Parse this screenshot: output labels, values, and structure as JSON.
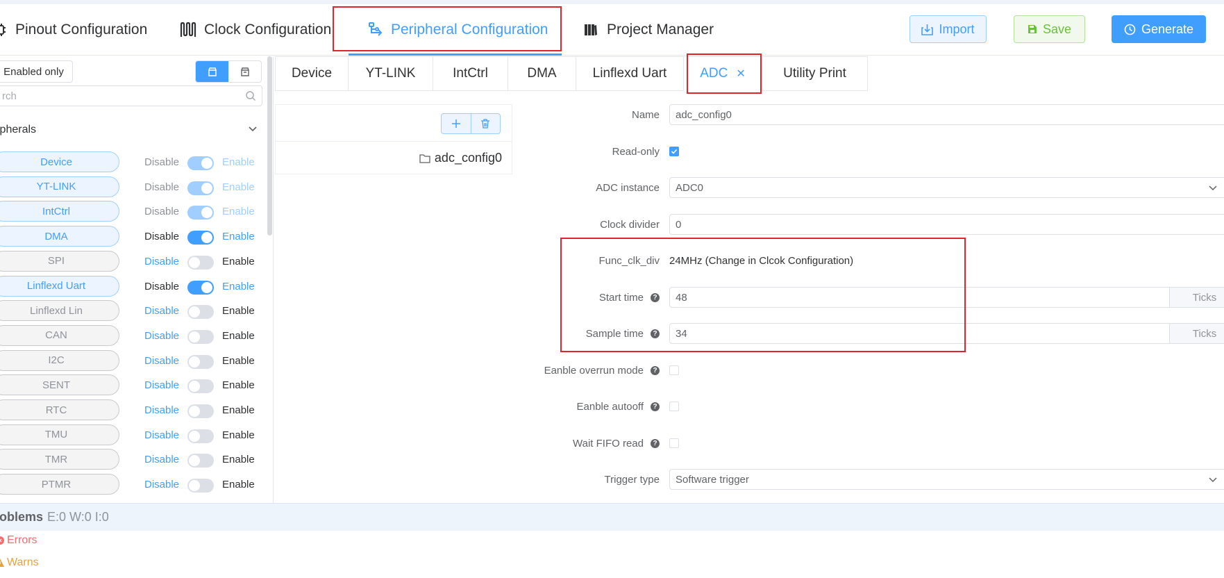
{
  "nav": {
    "tabs": [
      {
        "label": "Pinout Configuration",
        "icon": "chip-icon"
      },
      {
        "label": "Clock Configuration",
        "icon": "clock-wave-icon"
      },
      {
        "label": "Peripheral Configuration",
        "icon": "peripheral-icon"
      },
      {
        "label": "Project Manager",
        "icon": "book-icon"
      }
    ],
    "active": "Peripheral Configuration"
  },
  "actions": {
    "import": "Import",
    "save": "Save",
    "generate": "Generate"
  },
  "left": {
    "enabled_only": "Enabled only",
    "search_placeholder": "rch",
    "section_title": "ipherals",
    "disable_label": "Disable",
    "enable_label": "Enable",
    "peripherals": [
      {
        "name": "Device",
        "enabled": true,
        "locked": true
      },
      {
        "name": "YT-LINK",
        "enabled": true,
        "locked": true
      },
      {
        "name": "IntCtrl",
        "enabled": true,
        "locked": true
      },
      {
        "name": "DMA",
        "enabled": true,
        "locked": false
      },
      {
        "name": "SPI",
        "enabled": false,
        "locked": false
      },
      {
        "name": "Linflexd Uart",
        "enabled": true,
        "locked": false
      },
      {
        "name": "Linflexd Lin",
        "enabled": false,
        "locked": false
      },
      {
        "name": "CAN",
        "enabled": false,
        "locked": false
      },
      {
        "name": "I2C",
        "enabled": false,
        "locked": false
      },
      {
        "name": "SENT",
        "enabled": false,
        "locked": false
      },
      {
        "name": "RTC",
        "enabled": false,
        "locked": false
      },
      {
        "name": "TMU",
        "enabled": false,
        "locked": false
      },
      {
        "name": "TMR",
        "enabled": false,
        "locked": false
      },
      {
        "name": "PTMR",
        "enabled": false,
        "locked": false
      }
    ]
  },
  "peripheral_tabs": [
    "Device",
    "YT-LINK",
    "IntCtrl",
    "DMA",
    "Linflexd Uart",
    "ADC",
    "Utility Print"
  ],
  "active_peripheral_tab": "ADC",
  "config_list": {
    "items": [
      "adc_config0"
    ]
  },
  "form": {
    "name": {
      "label": "Name",
      "value": "adc_config0"
    },
    "readonly": {
      "label": "Read-only",
      "checked": true
    },
    "instance": {
      "label": "ADC instance",
      "value": "ADC0"
    },
    "clock_divider": {
      "label": "Clock divider",
      "value": "0"
    },
    "func_clk_div": {
      "label": "Func_clk_div",
      "value": "24MHz (Change in Clcok Configuration)"
    },
    "start_time": {
      "label": "Start time",
      "value": "48",
      "unit": "Ticks"
    },
    "sample_time": {
      "label": "Sample time",
      "value": "34",
      "unit": "Ticks"
    },
    "overrun": {
      "label": "Eanble overrun mode",
      "checked": false
    },
    "autooff": {
      "label": "Eanble autooff",
      "checked": false
    },
    "wait_fifo": {
      "label": "Wait FIFO read",
      "checked": false
    },
    "trigger": {
      "label": "Trigger type",
      "value": "Software trigger"
    }
  },
  "problems": {
    "title": "roblems",
    "counts": "E:0 W:0 I:0",
    "errors": "Errors",
    "warns": "Warns"
  },
  "colors": {
    "accent": "#409eff",
    "highlight": "#e0242c",
    "success": "#67c23a",
    "error": "#f56c6c",
    "warning": "#e6a23c"
  }
}
